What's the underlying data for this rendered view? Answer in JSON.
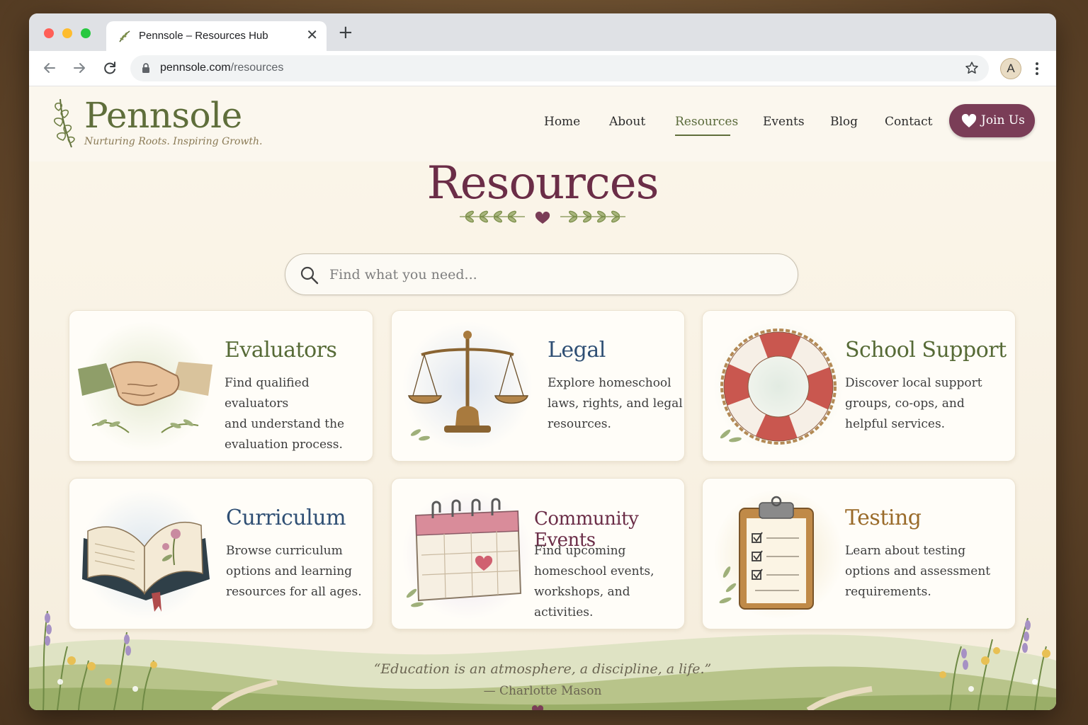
{
  "browser": {
    "tab_title": "Pennsole – Resources Hub",
    "url_domain": "pennsole.com",
    "url_path": "/resources",
    "profile_initial": "A"
  },
  "site": {
    "name": "Pennsole",
    "tagline": "Nurturing Roots. Inspiring Growth."
  },
  "nav": {
    "items": [
      "Home",
      "About",
      "Resources",
      "Events",
      "Blog",
      "Contact"
    ],
    "active": "Resources",
    "join_label": "Join Us"
  },
  "hero": {
    "title": "Resources",
    "search_placeholder": "Find what you need..."
  },
  "cards": [
    {
      "title": "Evaluators",
      "desc": [
        "Find qualified evaluators",
        "and understand the",
        "evaluation process."
      ],
      "color": "#566a36",
      "icon": "handshake-icon"
    },
    {
      "title": "Legal",
      "desc": [
        "Explore homeschool",
        "laws, rights, and legal",
        "resources."
      ],
      "color": "#2f4f74",
      "icon": "scales-icon"
    },
    {
      "title": "School Support",
      "desc": [
        "Discover local support",
        "groups, co-ops, and",
        "helpful services."
      ],
      "color": "#566a36",
      "icon": "life-ring-icon"
    },
    {
      "title": "Curriculum",
      "desc": [
        "Browse curriculum",
        "options and learning",
        "resources for all ages."
      ],
      "color": "#2f4f74",
      "icon": "open-book-icon"
    },
    {
      "title": "Community Events",
      "desc": [
        "Find upcoming",
        "homeschool events,",
        "workshops, and activities."
      ],
      "color": "#6b2d47",
      "icon": "calendar-icon"
    },
    {
      "title": "Testing",
      "desc": [
        "Learn about testing",
        "options and assessment",
        "requirements."
      ],
      "color": "#9a6b2a",
      "icon": "clipboard-icon"
    }
  ],
  "footer": {
    "quote": "“Education is an atmosphere, a discipline, a life.”",
    "author": "— Charlotte Mason"
  },
  "colors": {
    "brand_green": "#5f6e3b",
    "brand_plum": "#6b2d47",
    "join_button": "#7a3d57",
    "page_background": "#fbf6ea"
  }
}
